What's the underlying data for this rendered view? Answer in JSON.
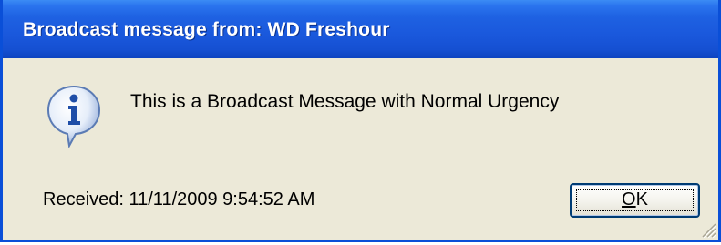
{
  "window": {
    "title": "Broadcast message from: WD Freshour"
  },
  "dialog": {
    "icon": "information-icon",
    "message": "This is a Broadcast Message with Normal Urgency",
    "received": "Received: 11/11/2009 9:54:52 AM"
  },
  "ok_button": {
    "accelerator": "O",
    "label_rest": "K"
  },
  "colors": {
    "titlebar": "#1a58dc",
    "window_face": "#ece9d8",
    "button_border": "#003c74"
  }
}
